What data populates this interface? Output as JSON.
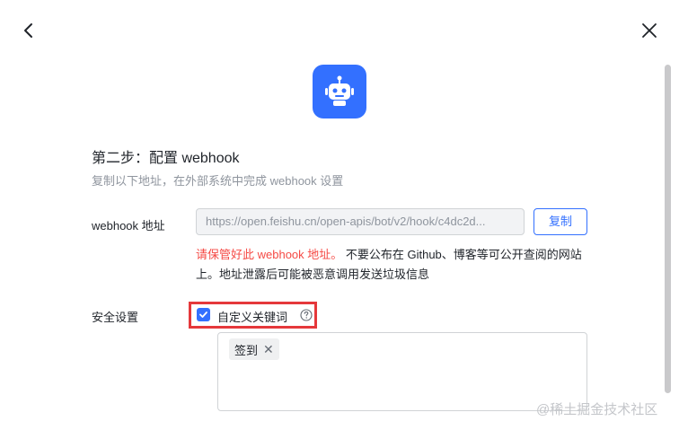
{
  "step": {
    "title": "第二步：配置 webhook",
    "description": "复制以下地址，在外部系统中完成 webhook 设置"
  },
  "webhook": {
    "label": "webhook 地址",
    "url": "https://open.feishu.cn/open-apis/bot/v2/hook/c4dc2d...",
    "copy_label": "复制",
    "warning_red": "请保管好此 webhook 地址。",
    "warning_rest": " 不要公布在 Github、博客等可公开查阅的网站上。地址泄露后可能被恶意调用发送垃圾信息"
  },
  "security": {
    "label": "安全设置",
    "custom_keyword_label": "自定义关键词",
    "custom_keyword_checked": true,
    "keywords": [
      "签到"
    ]
  },
  "watermark": "@稀土掘金技术社区",
  "colors": {
    "accent": "#3370ff",
    "warning": "#f54a45",
    "highlight": "#e5383b"
  }
}
